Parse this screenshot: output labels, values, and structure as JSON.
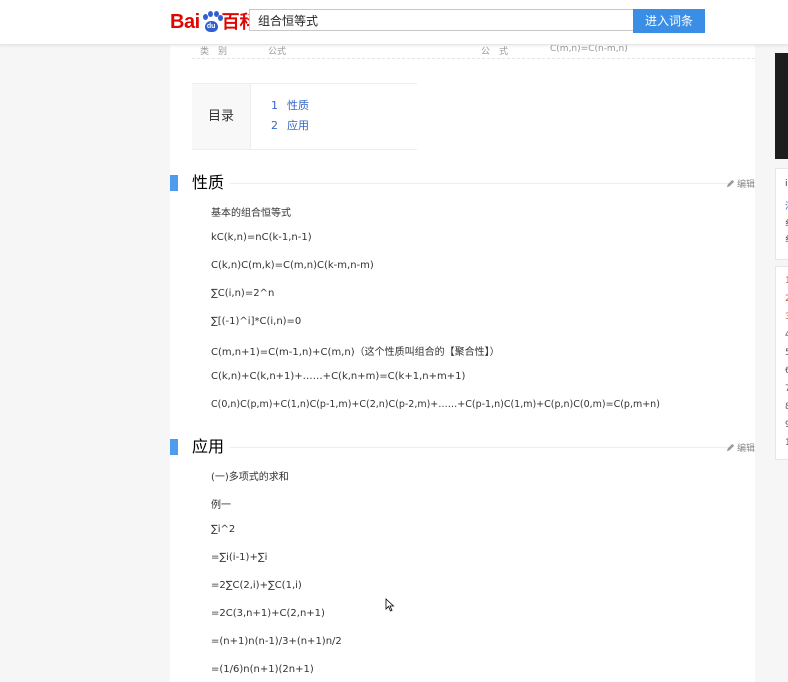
{
  "header": {
    "logo_bai": "Bai",
    "logo_du": "du",
    "logo_baike": "百科",
    "search_value": "组合恒等式",
    "enter_button": "进入词条"
  },
  "info_row": {
    "label_category": "类　别",
    "value_category": "公式",
    "label_formula": "公　式",
    "value_formula": "C(m,n)=C(n-m,n)"
  },
  "toc": {
    "title": "目录",
    "items": [
      {
        "num": "1",
        "label": "性质"
      },
      {
        "num": "2",
        "label": "应用"
      }
    ]
  },
  "edit_label": "编辑",
  "sections": {
    "properties": {
      "title": "性质",
      "lines": [
        "基本的组合恒等式",
        "kC(k,n)=nC(k-1,n-1)",
        "C(k,n)C(m,k)=C(m,n)C(k-m,n-m)",
        "∑C(i,n)=2^n",
        "∑[(-1)^i]*C(i,n)=0",
        "C(m,n+1)=C(m-1,n)+C(m,n)（这个性质叫组合的【聚合性】）",
        "C(k,n)+C(k,n+1)+……+C(k,n+m)=C(k+1,n+m+1)",
        "C(0,n)C(p,m)+C(1,n)C(p-1,m)+C(2,n)C(p-2,m)+……+C(p-1,n)C(1,m)+C(p,n)C(0,m)=C(p,m+n)"
      ]
    },
    "applications": {
      "title": "应用",
      "lines": [
        "(一)多项式的求和",
        "例一",
        "∑i^2",
        "=∑i(i-1)+∑i",
        "=2∑C(2,i)+∑C(1,i)",
        "=2C(3,n+1)+C(2,n+1)",
        "=(n+1)n(n-1)/3+(n+1)n/2",
        "=(1/6)n(n+1)(2n+1)"
      ]
    }
  },
  "sidebar": {
    "box1_chars": [
      "i",
      "注",
      "纟",
      "纟"
    ],
    "box2_chars": [
      "1",
      "2",
      "3",
      "4",
      "5",
      "6",
      "7",
      "8",
      "9",
      "1"
    ]
  }
}
